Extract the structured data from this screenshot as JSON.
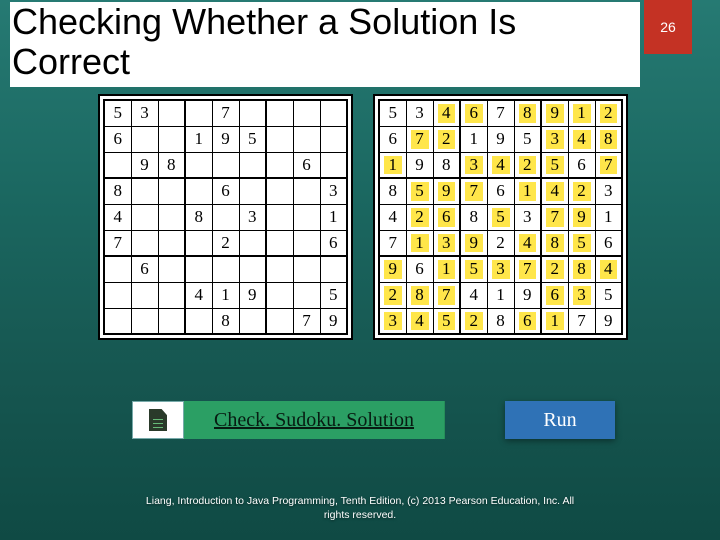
{
  "page_number": "26",
  "title": "Checking Whether a Solution Is Correct",
  "puzzle": [
    [
      "5",
      "3",
      "",
      "",
      "7",
      "",
      "",
      "",
      ""
    ],
    [
      "6",
      "",
      "",
      "1",
      "9",
      "5",
      "",
      "",
      ""
    ],
    [
      "",
      "9",
      "8",
      "",
      "",
      "",
      "",
      "6",
      ""
    ],
    [
      "8",
      "",
      "",
      "",
      "6",
      "",
      "",
      "",
      "3"
    ],
    [
      "4",
      "",
      "",
      "8",
      "",
      "3",
      "",
      "",
      "1"
    ],
    [
      "7",
      "",
      "",
      "",
      "2",
      "",
      "",
      "",
      "6"
    ],
    [
      "",
      "6",
      "",
      "",
      "",
      "",
      "",
      "",
      ""
    ],
    [
      "",
      "",
      "",
      "4",
      "1",
      "9",
      "",
      "",
      "5"
    ],
    [
      "",
      "",
      "",
      "",
      "8",
      "",
      "",
      "7",
      "9"
    ]
  ],
  "solution": [
    [
      "5",
      "3",
      "4",
      "6",
      "7",
      "8",
      "9",
      "1",
      "2"
    ],
    [
      "6",
      "7",
      "2",
      "1",
      "9",
      "5",
      "3",
      "4",
      "8"
    ],
    [
      "1",
      "9",
      "8",
      "3",
      "4",
      "2",
      "5",
      "6",
      "7"
    ],
    [
      "8",
      "5",
      "9",
      "7",
      "6",
      "1",
      "4",
      "2",
      "3"
    ],
    [
      "4",
      "2",
      "6",
      "8",
      "5",
      "3",
      "7",
      "9",
      "1"
    ],
    [
      "7",
      "1",
      "3",
      "9",
      "2",
      "4",
      "8",
      "5",
      "6"
    ],
    [
      "9",
      "6",
      "1",
      "5",
      "3",
      "7",
      "2",
      "8",
      "4"
    ],
    [
      "2",
      "8",
      "7",
      "4",
      "1",
      "9",
      "6",
      "3",
      "5"
    ],
    [
      "3",
      "4",
      "5",
      "2",
      "8",
      "6",
      "1",
      "7",
      "9"
    ]
  ],
  "buttons": {
    "check_label": "Check. Sudoku. Solution",
    "run_label": "Run"
  },
  "footer": {
    "line1": "Liang, Introduction to Java Programming, Tenth Edition, (c) 2013 Pearson Education, Inc. All",
    "line2": "rights reserved."
  }
}
